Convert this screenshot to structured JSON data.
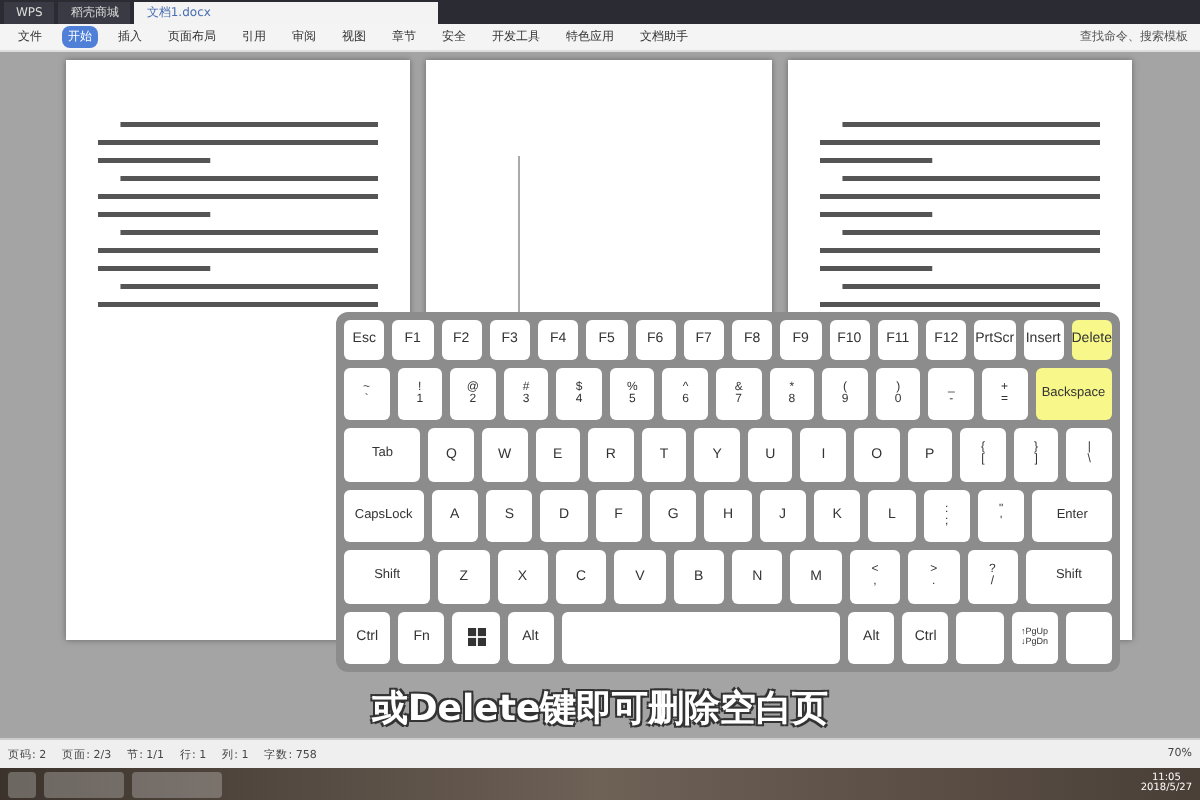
{
  "title_bar": {
    "tabs": [
      {
        "label": "WPS",
        "selected": false
      },
      {
        "label": "稻壳商城",
        "selected": false
      },
      {
        "label": "文档1.docx",
        "selected": true
      }
    ]
  },
  "menu_bar": {
    "items": [
      {
        "label": "文件",
        "selected": false
      },
      {
        "label": "开始",
        "selected": true
      },
      {
        "label": "插入",
        "selected": false
      },
      {
        "label": "页面布局",
        "selected": false
      },
      {
        "label": "引用",
        "selected": false
      },
      {
        "label": "审阅",
        "selected": false
      },
      {
        "label": "视图",
        "selected": false
      },
      {
        "label": "章节",
        "selected": false
      },
      {
        "label": "安全",
        "selected": false
      },
      {
        "label": "开发工具",
        "selected": false
      },
      {
        "label": "特色应用",
        "selected": false
      },
      {
        "label": "文档助手",
        "selected": false
      }
    ],
    "search": {
      "placeholder": "查找命令、搜索模板"
    }
  },
  "keyboard": {
    "rows": [
      {
        "keys": [
          {
            "kind": "single",
            "label": "Esc",
            "highlighted": false
          },
          {
            "kind": "single",
            "label": "F1",
            "highlighted": false
          },
          {
            "kind": "single",
            "label": "F2",
            "highlighted": false
          },
          {
            "kind": "single",
            "label": "F3",
            "highlighted": false
          },
          {
            "kind": "single",
            "label": "F4",
            "highlighted": false
          },
          {
            "kind": "single",
            "label": "F5",
            "highlighted": false
          },
          {
            "kind": "single",
            "label": "F6",
            "highlighted": false
          },
          {
            "kind": "single",
            "label": "F7",
            "highlighted": false
          },
          {
            "kind": "single",
            "label": "F8",
            "highlighted": false
          },
          {
            "kind": "single",
            "label": "F9",
            "highlighted": false
          },
          {
            "kind": "single",
            "label": "F10",
            "highlighted": false
          },
          {
            "kind": "single",
            "label": "F11",
            "highlighted": false
          },
          {
            "kind": "single",
            "label": "F12",
            "highlighted": false
          },
          {
            "kind": "single",
            "label": "PrtScr",
            "highlighted": false
          },
          {
            "kind": "single",
            "label": "Insert",
            "highlighted": false
          },
          {
            "kind": "single",
            "label": "Delete",
            "highlighted": true
          }
        ]
      },
      {
        "keys": [
          {
            "kind": "pair",
            "top": "~",
            "label": "`",
            "highlighted": false
          },
          {
            "kind": "pair",
            "top": "!",
            "label": "1",
            "highlighted": false
          },
          {
            "kind": "pair",
            "top": "@",
            "label": "2",
            "highlighted": false
          },
          {
            "kind": "pair",
            "top": "#",
            "label": "3",
            "highlighted": false
          },
          {
            "kind": "pair",
            "top": "$",
            "label": "4",
            "highlighted": false
          },
          {
            "kind": "pair",
            "top": "%",
            "label": "5",
            "highlighted": false
          },
          {
            "kind": "pair",
            "top": "^",
            "label": "6",
            "highlighted": false
          },
          {
            "kind": "pair",
            "top": "&",
            "label": "7",
            "highlighted": false
          },
          {
            "kind": "pair",
            "top": "*",
            "label": "8",
            "highlighted": false
          },
          {
            "kind": "pair",
            "top": "(",
            "label": "9",
            "highlighted": false
          },
          {
            "kind": "pair",
            "top": ")",
            "label": "0",
            "highlighted": false
          },
          {
            "kind": "pair",
            "top": "_",
            "label": "-",
            "highlighted": false
          },
          {
            "kind": "pair",
            "top": "+",
            "label": "=",
            "highlighted": false
          },
          {
            "kind": "wide",
            "label": "Backspace",
            "highlighted": true
          }
        ]
      },
      {
        "keys": [
          {
            "kind": "wide",
            "label": "Tab",
            "highlighted": false
          },
          {
            "kind": "single",
            "label": "Q",
            "highlighted": false
          },
          {
            "kind": "single",
            "label": "W",
            "highlighted": false
          },
          {
            "kind": "single",
            "label": "E",
            "highlighted": false
          },
          {
            "kind": "single",
            "label": "R",
            "highlighted": false
          },
          {
            "kind": "single",
            "label": "T",
            "highlighted": false
          },
          {
            "kind": "single",
            "label": "Y",
            "highlighted": false
          },
          {
            "kind": "single",
            "label": "U",
            "highlighted": false
          },
          {
            "kind": "single",
            "label": "I",
            "highlighted": false
          },
          {
            "kind": "single",
            "label": "O",
            "highlighted": false
          },
          {
            "kind": "single",
            "label": "P",
            "highlighted": false
          },
          {
            "kind": "pair",
            "top": "{",
            "label": "[",
            "highlighted": false
          },
          {
            "kind": "pair",
            "top": "}",
            "label": "]",
            "highlighted": false
          },
          {
            "kind": "pair",
            "top": "|",
            "label": "\\",
            "highlighted": false
          }
        ]
      },
      {
        "keys": [
          {
            "kind": "wide",
            "label": "CapsLock",
            "highlighted": false
          },
          {
            "kind": "single",
            "label": "A",
            "highlighted": false
          },
          {
            "kind": "single",
            "label": "S",
            "highlighted": false
          },
          {
            "kind": "single",
            "label": "D",
            "highlighted": false
          },
          {
            "kind": "single",
            "label": "F",
            "highlighted": false
          },
          {
            "kind": "single",
            "label": "G",
            "highlighted": false
          },
          {
            "kind": "single",
            "label": "H",
            "highlighted": false
          },
          {
            "kind": "single",
            "label": "J",
            "highlighted": false
          },
          {
            "kind": "single",
            "label": "K",
            "highlighted": false
          },
          {
            "kind": "single",
            "label": "L",
            "highlighted": false
          },
          {
            "kind": "pair",
            "top": ":",
            "label": ";",
            "highlighted": false
          },
          {
            "kind": "pair",
            "top": "\"",
            "label": "'",
            "highlighted": false
          },
          {
            "kind": "wide",
            "label": "Enter",
            "highlighted": false
          }
        ]
      },
      {
        "keys": [
          {
            "kind": "wide",
            "label": "Shift",
            "highlighted": false
          },
          {
            "kind": "single",
            "label": "Z",
            "highlighted": false
          },
          {
            "kind": "single",
            "label": "X",
            "highlighted": false
          },
          {
            "kind": "single",
            "label": "C",
            "highlighted": false
          },
          {
            "kind": "single",
            "label": "V",
            "highlighted": false
          },
          {
            "kind": "single",
            "label": "B",
            "highlighted": false
          },
          {
            "kind": "single",
            "label": "N",
            "highlighted": false
          },
          {
            "kind": "single",
            "label": "M",
            "highlighted": false
          },
          {
            "kind": "pair",
            "top": "<",
            "label": ",",
            "highlighted": false
          },
          {
            "kind": "pair",
            "top": ">",
            "label": ".",
            "highlighted": false
          },
          {
            "kind": "pair",
            "top": "?",
            "label": "/",
            "highlighted": false
          },
          {
            "kind": "wide",
            "label": "Shift",
            "highlighted": false
          }
        ]
      },
      {
        "keys": [
          {
            "kind": "single",
            "label": "Ctrl",
            "highlighted": false
          },
          {
            "kind": "single",
            "label": "Fn",
            "highlighted": false
          },
          {
            "kind": "windows",
            "highlighted": false
          },
          {
            "kind": "single",
            "label": "Alt",
            "highlighted": false
          },
          {
            "kind": "space",
            "highlighted": false
          },
          {
            "kind": "single",
            "label": "Alt",
            "highlighted": false
          },
          {
            "kind": "single",
            "label": "Ctrl",
            "highlighted": false
          },
          {
            "kind": "blank",
            "highlighted": false
          },
          {
            "kind": "stack",
            "top": "↑PgUp",
            "label": "↓PgDn",
            "highlighted": false
          },
          {
            "kind": "blank",
            "highlighted": false
          }
        ]
      }
    ]
  },
  "subtitle": "或Delete键即可删除空白页",
  "status_bar": {
    "items": [
      "页码: 2",
      "页面: 2/3",
      "节: 1/1",
      "行: 1",
      "列: 1",
      "字数: 758"
    ],
    "zoom": "70%"
  },
  "taskbar": {
    "clock_time": "11:05",
    "clock_date": "2018/5/27"
  }
}
